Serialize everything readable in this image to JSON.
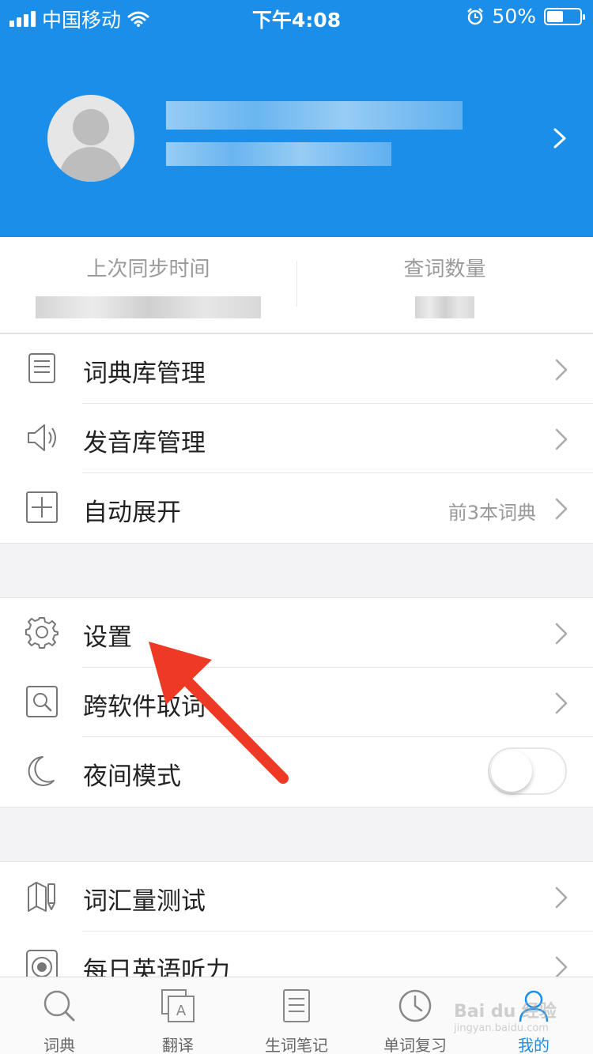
{
  "status_bar": {
    "carrier": "中国移动",
    "time": "下午4:08",
    "battery": "50%",
    "battery_level": 0.5
  },
  "profile": {
    "avatar": "default-avatar"
  },
  "stats": [
    {
      "label": "上次同步时间"
    },
    {
      "label": "查词数量"
    }
  ],
  "menu": {
    "group1": [
      {
        "label": "词典库管理",
        "icon": "book-icon"
      },
      {
        "label": "发音库管理",
        "icon": "speaker-icon"
      },
      {
        "label": "自动展开",
        "icon": "plus-box-icon",
        "extra": "前3本词典"
      }
    ],
    "group2": [
      {
        "label": "设置",
        "icon": "gear-icon"
      },
      {
        "label": "跨软件取词",
        "icon": "search-box-icon"
      },
      {
        "label": "夜间模式",
        "icon": "moon-icon",
        "toggle": false
      }
    ],
    "group3": [
      {
        "label": "词汇量测试",
        "icon": "test-icon"
      },
      {
        "label": "每日英语听力",
        "icon": "listen-icon"
      }
    ]
  },
  "tabs": [
    {
      "label": "词典",
      "icon": "search-icon"
    },
    {
      "label": "翻译",
      "icon": "translate-icon"
    },
    {
      "label": "生词笔记",
      "icon": "notes-icon"
    },
    {
      "label": "单词复习",
      "icon": "clock-icon"
    },
    {
      "label": "我的",
      "icon": "person-icon",
      "active": true
    }
  ],
  "watermark": {
    "text": "Bai du 经验",
    "sub": "jingyan.baidu.com"
  },
  "colors": {
    "accent": "#1a8ee8",
    "annotation_arrow": "#ee3a24"
  }
}
